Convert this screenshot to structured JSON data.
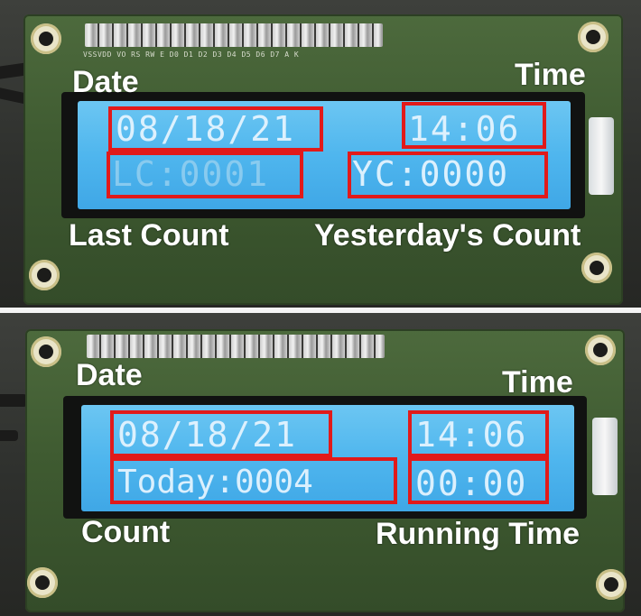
{
  "top_panel": {
    "lcd_lines": {
      "date": "08/18/21",
      "time": "14:06",
      "last_count": "LC:0001",
      "yesterday_count": "YC:0000"
    },
    "labels": {
      "date": "Date",
      "time": "Time",
      "last_count": "Last Count",
      "yesterday_count": "Yesterday's Count"
    },
    "pin_labels": "VSSVDD VO RS RW E D0 D1 D2 D3 D4 D5 D6 D7 A K"
  },
  "bottom_panel": {
    "lcd_lines": {
      "date": "08/18/21",
      "time": "14:06",
      "today_count": "Today:0004",
      "running_time": "00:00"
    },
    "labels": {
      "date": "Date",
      "time": "Time",
      "count": "Count",
      "running_time": "Running Time"
    }
  },
  "colors": {
    "highlight_box": "#e11a1a",
    "lcd_background": "#4fb6ee",
    "pcb": "#3f5b31",
    "label_text": "#ffffff"
  }
}
